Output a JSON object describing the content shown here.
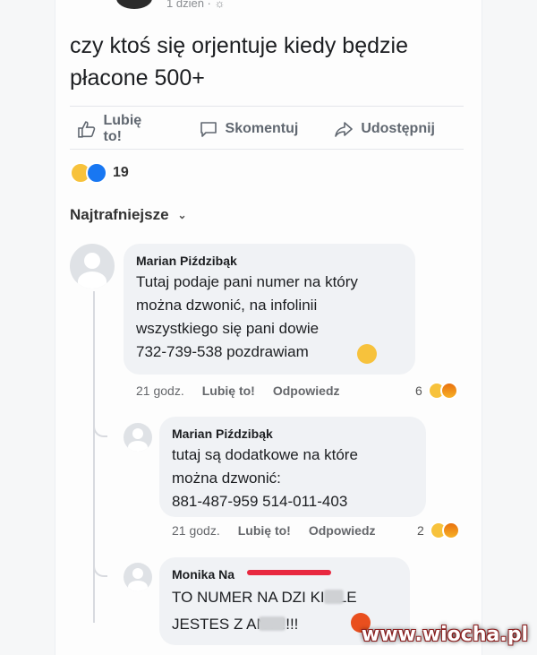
{
  "post": {
    "time": "1 dzień",
    "text": "czy ktoś się orjentuje kiedy będzie płacone 500+"
  },
  "actions": {
    "like": "Lubię to!",
    "comment": "Skomentuj",
    "share": "Udostępnij"
  },
  "reactions": {
    "count": "19",
    "icons": [
      "haha-icon",
      "like-icon"
    ]
  },
  "sort_label": "Najtrafniejsze",
  "comments": [
    {
      "author": "Marian Piździbąk",
      "text": "Tutaj podaje pani numer na który\nmożna dzwonić, na infolinii\nwszystkiego się pani dowie\n732-739-538 pozdrawiam",
      "time": "21 godz.",
      "like": "Lubię to!",
      "reply": "Odpowiedz",
      "reaction_count": "6"
    },
    {
      "author": "Marian Piździbąk",
      "text": "tutaj są dodatkowe na które\nmożna dzwonić:\n 881-487-959    514-011-403",
      "time": "21 godz.",
      "like": "Lubię to!",
      "reply": "Odpowiedz",
      "reaction_count": "2"
    },
    {
      "author": "Monika Na",
      "text": "TO NUMER NA DZI    KI ALE\nJESTES Z     ANY !!!!"
    }
  ],
  "watermark": "www.wiocha.pl",
  "colors": {
    "accent": "#1877f2",
    "bubble": "#f0f2f5",
    "muted": "#65676b",
    "redact": "#e8283f"
  }
}
